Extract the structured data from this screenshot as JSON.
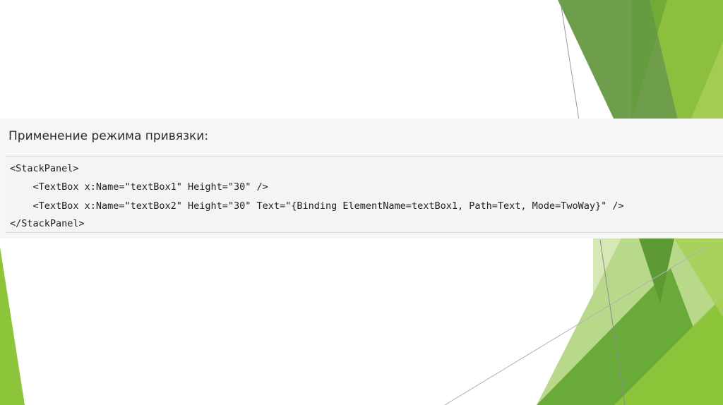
{
  "heading": "Применение режима привязки:",
  "code": {
    "lines": [
      "<StackPanel>",
      "    <TextBox x:Name=\"textBox1\" Height=\"30\" />",
      "    <TextBox x:Name=\"textBox2\" Height=\"30\" Text=\"{Binding ElementName=textBox1, Path=Text, Mode=TwoWay}\" />",
      "</StackPanel>"
    ]
  },
  "colors": {
    "green_dark": "#5e9a34",
    "green_mid": "#7cb53b",
    "green_light": "#9cc94a",
    "green_pale": "#cde3a2",
    "band": "#f6f6f7"
  }
}
